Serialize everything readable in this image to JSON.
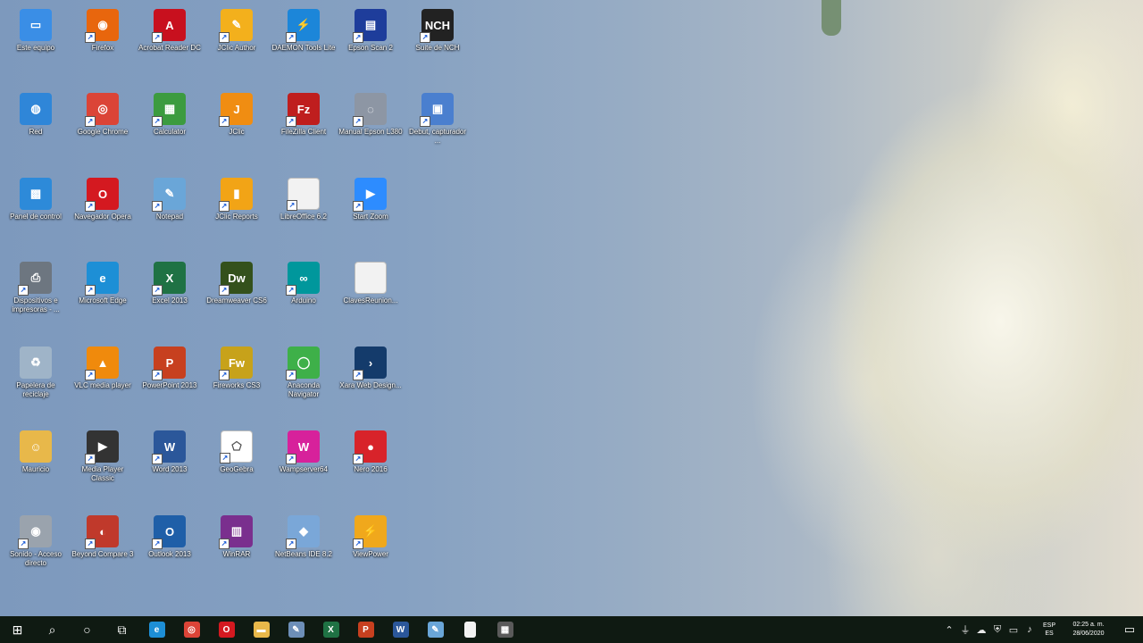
{
  "desktop": {
    "icons": [
      {
        "label": "Este equipo",
        "icon": "pc-icon",
        "color": "#3a8ee6",
        "glyph": "▭",
        "shortcut": false
      },
      {
        "label": "Firefox",
        "icon": "firefox-icon",
        "color": "#e8660d",
        "glyph": "◉",
        "shortcut": true
      },
      {
        "label": "Acrobat Reader DC",
        "icon": "acrobat-reader-icon",
        "color": "#c8101e",
        "glyph": "A",
        "shortcut": true
      },
      {
        "label": "JClic Author",
        "icon": "jclic-author-icon",
        "color": "#f3b01c",
        "glyph": "✎",
        "shortcut": true
      },
      {
        "label": "DAEMON Tools Lite",
        "icon": "daemon-tools-icon",
        "color": "#1c86d9",
        "glyph": "⚡",
        "shortcut": true
      },
      {
        "label": "Epson Scan 2",
        "icon": "epson-scan-icon",
        "color": "#1e3d9b",
        "glyph": "▤",
        "shortcut": true
      },
      {
        "label": "Suite de NCH",
        "icon": "nch-suite-icon",
        "color": "#222222",
        "glyph": "NCH",
        "shortcut": true
      },
      {
        "label": "Red",
        "icon": "network-icon",
        "color": "#2f86d8",
        "glyph": "◍",
        "shortcut": false
      },
      {
        "label": "Google Chrome",
        "icon": "chrome-icon",
        "color": "#db4437",
        "glyph": "◎",
        "shortcut": true
      },
      {
        "label": "Calculator",
        "icon": "calculator-icon",
        "color": "#3c9b3f",
        "glyph": "▦",
        "shortcut": true
      },
      {
        "label": "JClic",
        "icon": "jclic-icon",
        "color": "#f08d12",
        "glyph": "J",
        "shortcut": true
      },
      {
        "label": "FileZilla Client",
        "icon": "filezilla-icon",
        "color": "#bf1e1e",
        "glyph": "Fz",
        "shortcut": true
      },
      {
        "label": "Manual Epson L380",
        "icon": "epson-manual-icon",
        "color": "#8d96a4",
        "glyph": "◌",
        "shortcut": true
      },
      {
        "label": "Debut, capturador ...",
        "icon": "debut-icon",
        "color": "#4a7fcf",
        "glyph": "▣",
        "shortcut": true
      },
      {
        "label": "Panel de control",
        "icon": "control-panel-icon",
        "color": "#2d8ad9",
        "glyph": "▩",
        "shortcut": false
      },
      {
        "label": "Navegador Opera",
        "icon": "opera-icon",
        "color": "#d41920",
        "glyph": "O",
        "shortcut": true
      },
      {
        "label": "Notepad",
        "icon": "notepad-icon",
        "color": "#6aa6d8",
        "glyph": "✎",
        "shortcut": true
      },
      {
        "label": "JClic Reports",
        "icon": "jclic-reports-icon",
        "color": "#f2a416",
        "glyph": "▮",
        "shortcut": true
      },
      {
        "label": "LibreOffice 6.2",
        "icon": "libreoffice-icon",
        "color": "#f2f2f2",
        "glyph": "",
        "shortcut": true
      },
      {
        "label": "Start Zoom",
        "icon": "zoom-icon",
        "color": "#2d8cff",
        "glyph": "▶",
        "shortcut": true
      },
      {
        "label": "Dispositivos e impresoras - ...",
        "icon": "devices-printers-icon",
        "color": "#6d7680",
        "glyph": "⎙",
        "shortcut": true
      },
      {
        "label": "Microsoft Edge",
        "icon": "edge-icon",
        "color": "#1d8fd6",
        "glyph": "e",
        "shortcut": true
      },
      {
        "label": "Excel 2013",
        "icon": "excel-icon",
        "color": "#1f7244",
        "glyph": "X",
        "shortcut": true
      },
      {
        "label": "Dreamweaver CS6",
        "icon": "dreamweaver-icon",
        "color": "#34511c",
        "glyph": "Dw",
        "shortcut": true
      },
      {
        "label": "Arduino",
        "icon": "arduino-icon",
        "color": "#00979c",
        "glyph": "∞",
        "shortcut": true
      },
      {
        "label": "ClavesReunion...",
        "icon": "text-file-icon",
        "color": "#f2f2f2",
        "glyph": "",
        "shortcut": false
      },
      {
        "label": "Papelera de reciclaje",
        "icon": "recycle-bin-icon",
        "color": "#9fb4c8",
        "glyph": "♻",
        "shortcut": false
      },
      {
        "label": "VLC media player",
        "icon": "vlc-icon",
        "color": "#f08a0c",
        "glyph": "▲",
        "shortcut": true
      },
      {
        "label": "PowerPoint 2013",
        "icon": "powerpoint-icon",
        "color": "#c7401f",
        "glyph": "P",
        "shortcut": true
      },
      {
        "label": "Fireworks CS3",
        "icon": "fireworks-icon",
        "color": "#c7a21a",
        "glyph": "Fw",
        "shortcut": true
      },
      {
        "label": "Anaconda Navigator",
        "icon": "anaconda-icon",
        "color": "#3eb049",
        "glyph": "◯",
        "shortcut": true
      },
      {
        "label": "Xara Web Design...",
        "icon": "xara-icon",
        "color": "#143b6b",
        "glyph": "›",
        "shortcut": true
      },
      {
        "label": "Mauricio",
        "icon": "user-folder-icon",
        "color": "#e8b84a",
        "glyph": "☺",
        "shortcut": false
      },
      {
        "label": "Media Player Classic",
        "icon": "media-player-classic-icon",
        "color": "#333333",
        "glyph": "▶",
        "shortcut": true
      },
      {
        "label": "Word 2013",
        "icon": "word-icon",
        "color": "#2b579a",
        "glyph": "W",
        "shortcut": true
      },
      {
        "label": "GeoGebra",
        "icon": "geogebra-icon",
        "color": "#ffffff",
        "glyph": "⬠",
        "shortcut": true
      },
      {
        "label": "Wampserver64",
        "icon": "wampserver-icon",
        "color": "#d7219b",
        "glyph": "W",
        "shortcut": true
      },
      {
        "label": "Nero 2016",
        "icon": "nero-icon",
        "color": "#d8232a",
        "glyph": "●",
        "shortcut": true
      },
      {
        "label": "Sonido - Acceso directo",
        "icon": "sound-icon",
        "color": "#9aa3ad",
        "glyph": "◉",
        "shortcut": true
      },
      {
        "label": "Beyond Compare 3",
        "icon": "beyond-compare-icon",
        "color": "#c0392b",
        "glyph": "◐",
        "shortcut": true
      },
      {
        "label": "Outlook 2013",
        "icon": "outlook-icon",
        "color": "#1f5fa8",
        "glyph": "O",
        "shortcut": true
      },
      {
        "label": "WinRAR",
        "icon": "winrar-icon",
        "color": "#7a2f8e",
        "glyph": "▥",
        "shortcut": true
      },
      {
        "label": "NetBeans IDE 8.2",
        "icon": "netbeans-icon",
        "color": "#7aa7d8",
        "glyph": "◆",
        "shortcut": true
      },
      {
        "label": "ViewPower",
        "icon": "viewpower-icon",
        "color": "#f0a81c",
        "glyph": "⚡",
        "shortcut": true
      }
    ]
  },
  "taskbar": {
    "items": [
      {
        "icon": "windows-start-icon",
        "glyph": "⊞",
        "color": "transparent",
        "open": false
      },
      {
        "icon": "search-icon",
        "glyph": "⌕",
        "color": "transparent",
        "open": false
      },
      {
        "icon": "cortana-icon",
        "glyph": "○",
        "color": "transparent",
        "open": false
      },
      {
        "icon": "task-view-icon",
        "glyph": "⧉",
        "color": "transparent",
        "open": false
      },
      {
        "icon": "edge-icon",
        "glyph": "e",
        "color": "#1d8fd6",
        "open": false
      },
      {
        "icon": "chrome-icon",
        "glyph": "◎",
        "color": "#db4437",
        "open": false
      },
      {
        "icon": "opera-icon",
        "glyph": "O",
        "color": "#d41920",
        "open": false
      },
      {
        "icon": "file-explorer-icon",
        "glyph": "▬",
        "color": "#e8b84a",
        "open": false
      },
      {
        "icon": "paint-icon",
        "glyph": "✎",
        "color": "#6d8fb8",
        "open": false
      },
      {
        "icon": "excel-icon",
        "glyph": "X",
        "color": "#1f7244",
        "open": false
      },
      {
        "icon": "powerpoint-icon",
        "glyph": "P",
        "color": "#c7401f",
        "open": false
      },
      {
        "icon": "word-icon",
        "glyph": "W",
        "color": "#2b579a",
        "open": false
      },
      {
        "icon": "notepad-icon",
        "glyph": "✎",
        "color": "#6aa6d8",
        "open": false
      },
      {
        "icon": "file-icon",
        "glyph": "",
        "color": "#f2f2f2",
        "open": false
      },
      {
        "icon": "calculator-icon",
        "glyph": "▦",
        "color": "#5a5a5a",
        "open": false
      }
    ],
    "tray": {
      "icons": [
        {
          "icon": "chevron-up-icon",
          "glyph": "⌃"
        },
        {
          "icon": "usb-icon",
          "glyph": "⏚"
        },
        {
          "icon": "onedrive-icon",
          "glyph": "☁"
        },
        {
          "icon": "defender-icon",
          "glyph": "⛨"
        },
        {
          "icon": "network-tray-icon",
          "glyph": "▭"
        },
        {
          "icon": "volume-icon",
          "glyph": "♪"
        }
      ],
      "lang_top": "ESP",
      "lang_bottom": "ES",
      "time": "02:25 a. m.",
      "date": "28/06/2020"
    }
  }
}
